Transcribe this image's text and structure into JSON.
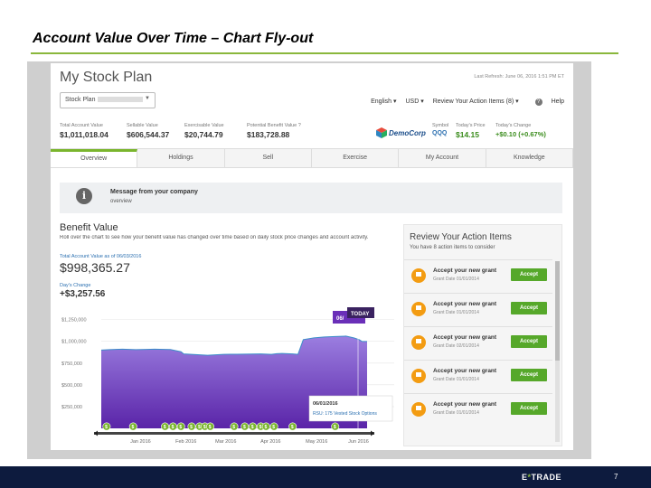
{
  "slide": {
    "title": "Account Value Over Time – Chart Fly-out",
    "page_number": "7"
  },
  "footer": {
    "brand_prefix": "E",
    "brand_star": "*",
    "brand_suffix": "TRADE"
  },
  "app": {
    "title": "My Stock Plan",
    "last_refresh": "Last Refresh: June 06, 2016 1:51 PM ET",
    "plan_select": {
      "value": "Stock Plan"
    },
    "top_links": {
      "language": "English ▾",
      "currency": "USD ▾",
      "review": "Review Your Action Items (8) ▾",
      "help": "Help"
    },
    "metrics": [
      {
        "label": "Total Account Value",
        "value": "$1,011,018.04"
      },
      {
        "label": "Sellable Value",
        "value": "$606,544.37"
      },
      {
        "label": "Exercisable Value",
        "value": "$20,744.79"
      },
      {
        "label": "Potential Benefit Value ?",
        "value": "$183,728.88"
      }
    ],
    "stock": {
      "logo_text": "DemoCorp",
      "symbol_label": "Symbol",
      "symbol": "QQQ",
      "price_label": "Today's Price",
      "price": "$14.15",
      "change_label": "Today's Change",
      "change": "+$0.10 (+0.67%)"
    },
    "tabs": [
      "Overview",
      "Holdings",
      "Sell",
      "Exercise",
      "My Account",
      "Knowledge"
    ],
    "message": {
      "title": "Message from your company",
      "body": "overview"
    },
    "benefit": {
      "title": "Benefit Value",
      "description": "Roll over the chart to see how your benefit value has changed over time based on daily stock price changes and account activity.",
      "value_label": "Total Account Value as of 06/03/2016",
      "value": "$998,365.27",
      "days_label": "Day's Change",
      "days_value": "+$3,257.56"
    },
    "action_panel": {
      "title": "Review Your Action Items",
      "subtitle": "You have 8 action items to consider",
      "items": [
        {
          "title": "Accept your new grant",
          "date": "Grant Date 01/01/2014",
          "button": "Accept"
        },
        {
          "title": "Accept your new grant",
          "date": "Grant Date 01/01/2014",
          "button": "Accept"
        },
        {
          "title": "Accept your new grant",
          "date": "Grant Date 02/01/2014",
          "button": "Accept"
        },
        {
          "title": "Accept your new grant",
          "date": "Grant Date 01/01/2014",
          "button": "Accept"
        },
        {
          "title": "Accept your new grant",
          "date": "Grant Date 01/01/2014",
          "button": "Accept"
        }
      ]
    }
  },
  "chart_data": {
    "type": "area",
    "y_ticks": [
      "$1,250,000",
      "$1,000,000",
      "$750,000",
      "$500,000",
      "$250,000"
    ],
    "x_ticks": [
      "Jan 2016",
      "Feb 2016",
      "Mar 2016",
      "Apr 2016",
      "May 2016",
      "Jun 2016"
    ],
    "ylim": [
      0,
      1350000
    ],
    "x_range": [
      0,
      1
    ],
    "series": [
      {
        "x": [
          0,
          0.03,
          0.08,
          0.13,
          0.17,
          0.2,
          0.26,
          0.3,
          0.31,
          0.4,
          0.46,
          0.51,
          0.6,
          0.64,
          0.66,
          0.68,
          0.72,
          0.74,
          0.76,
          0.8,
          0.84,
          0.88,
          0.92,
          0.95,
          0.97,
          0.98,
          1.0
        ],
        "values": [
          900000,
          905000,
          910000,
          905000,
          908000,
          910000,
          906000,
          880000,
          855000,
          840000,
          850000,
          852000,
          856000,
          850000,
          858000,
          860000,
          855000,
          850000,
          1020000,
          1040000,
          1050000,
          1055000,
          1060000,
          1040000,
          1020000,
          1000000,
          998365
        ]
      }
    ],
    "tooltip": {
      "value_tag": "06/",
      "today_tag": "TODAY",
      "date": "06/01/2016",
      "event": "RSU: 175 Vested Stock Options"
    },
    "event_markers": {
      "x": [
        0.02,
        0.12,
        0.24,
        0.27,
        0.3,
        0.34,
        0.37,
        0.39,
        0.41,
        0.5,
        0.54,
        0.57,
        0.6,
        0.62,
        0.65,
        0.72,
        0.88
      ],
      "labels": [
        "$",
        "$",
        "$",
        "$",
        "$",
        "$",
        "$",
        "$",
        "$",
        "$",
        "$",
        "$",
        "$",
        "$",
        "$",
        "$",
        "$"
      ]
    }
  },
  "colors": {
    "accent_green": "#8ab73c",
    "area_top": "#8f6cd6",
    "area_bottom": "#6a2fb8",
    "line": "#3c8ec9",
    "footer": "#0d1b3e"
  }
}
